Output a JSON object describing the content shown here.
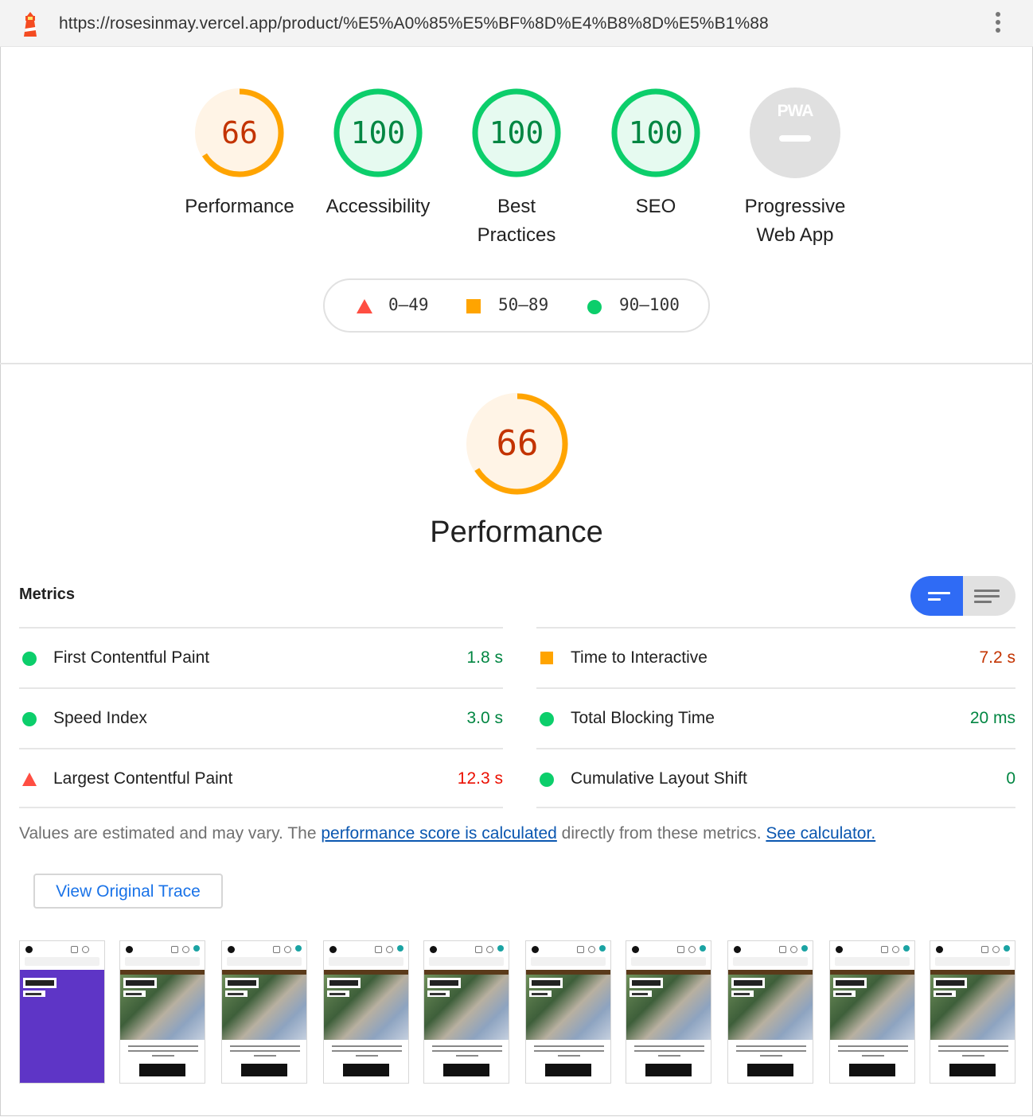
{
  "browser": {
    "url": "https://rosesinmay.vercel.app/product/%E5%A0%85%E5%BF%8D%E4%B8%8D%E5%B1%88",
    "logo_icon": "lighthouse-icon",
    "menu_icon": "more-vertical-icon"
  },
  "scores": [
    {
      "label": "Performance",
      "value": "66",
      "score": 0.66,
      "color": "#ffa400"
    },
    {
      "label": "Accessibility",
      "value": "100",
      "score": 1.0,
      "color": "#0cce6b"
    },
    {
      "label": "Best Practices",
      "value": "100",
      "score": 1.0,
      "color": "#0cce6b"
    },
    {
      "label": "SEO",
      "value": "100",
      "score": 1.0,
      "color": "#0cce6b"
    },
    {
      "label": "Progressive Web App",
      "badge": "PWA",
      "color": "#e0e0e0"
    }
  ],
  "score_labels": {
    "best_line1": "Best",
    "best_line2": "Practices",
    "pwa_line1": "Progressive",
    "pwa_line2": "Web App"
  },
  "legend": {
    "fail": "0–49",
    "average": "50–89",
    "pass": "90–100"
  },
  "performance": {
    "score": "66",
    "score_fraction": 0.66,
    "title": "Performance"
  },
  "metrics": {
    "heading": "Metrics",
    "left": [
      {
        "name": "First Contentful Paint",
        "value": "1.8 s",
        "status": "pass"
      },
      {
        "name": "Speed Index",
        "value": "3.0 s",
        "status": "pass"
      },
      {
        "name": "Largest Contentful Paint",
        "value": "12.3 s",
        "status": "fail"
      }
    ],
    "right": [
      {
        "name": "Time to Interactive",
        "value": "7.2 s",
        "status": "average"
      },
      {
        "name": "Total Blocking Time",
        "value": "20 ms",
        "status": "pass"
      },
      {
        "name": "Cumulative Layout Shift",
        "value": "0",
        "status": "pass"
      }
    ]
  },
  "note": {
    "text1": "Values are estimated and may vary. The ",
    "link1": "performance score is calculated",
    "text2": " directly from these metrics. ",
    "link2": "See calculator."
  },
  "trace_button": "View Original Trace",
  "colors": {
    "pass": "#0cce6b",
    "pass_text": "#018642",
    "average": "#ffa400",
    "average_text": "#c33300",
    "fail": "#ff4e42",
    "fail_text": "#eb0f00",
    "toggle_active": "#2f6bf5"
  }
}
